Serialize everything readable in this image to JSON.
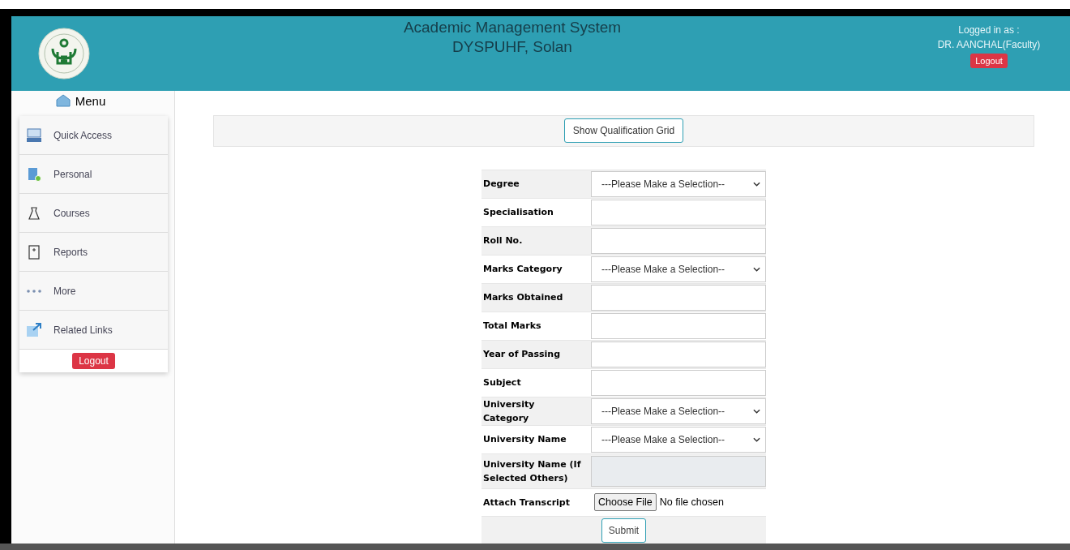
{
  "header": {
    "title": "Academic Management System",
    "subtitle": "DYSPUHF, Solan",
    "user_label": "Logged in as :",
    "user_name": "DR. AANCHAL(Faculty)",
    "logout": "Logout"
  },
  "sidebar": {
    "title": "Menu",
    "items": [
      {
        "label": "Quick Access",
        "kind": "monitor"
      },
      {
        "label": "Personal",
        "kind": "person"
      },
      {
        "label": "Courses",
        "kind": "bag"
      },
      {
        "label": "Reports",
        "kind": "report"
      },
      {
        "label": "More",
        "kind": "dots"
      },
      {
        "label": "Related Links",
        "kind": "link"
      }
    ],
    "logout": "Logout"
  },
  "toolbar": {
    "button": "Show Qualification Grid"
  },
  "form": {
    "rows": [
      {
        "label": "Degree",
        "kind": "select",
        "placeholder": "---Please Make a Selection--"
      },
      {
        "label": "Specialisation",
        "kind": "text"
      },
      {
        "label": "Roll No.",
        "kind": "text"
      },
      {
        "label": "Marks Category",
        "kind": "select",
        "placeholder": "---Please Make a Selection--"
      },
      {
        "label": "Marks Obtained",
        "kind": "text"
      },
      {
        "label": "Total Marks",
        "kind": "text"
      },
      {
        "label": "Year of Passing",
        "kind": "text"
      },
      {
        "label": "Subject",
        "kind": "text"
      },
      {
        "label": "University Category",
        "kind": "select",
        "placeholder": "---Please Make a Selection--"
      },
      {
        "label": "University Name",
        "kind": "select",
        "placeholder": "---Please Make a Selection--"
      },
      {
        "label": "University Name (If Selected Others)",
        "kind": "disabled"
      },
      {
        "label": "Attach Transcript",
        "kind": "file",
        "button": "Choose File",
        "status": "No file chosen"
      }
    ],
    "submit": "Submit"
  }
}
